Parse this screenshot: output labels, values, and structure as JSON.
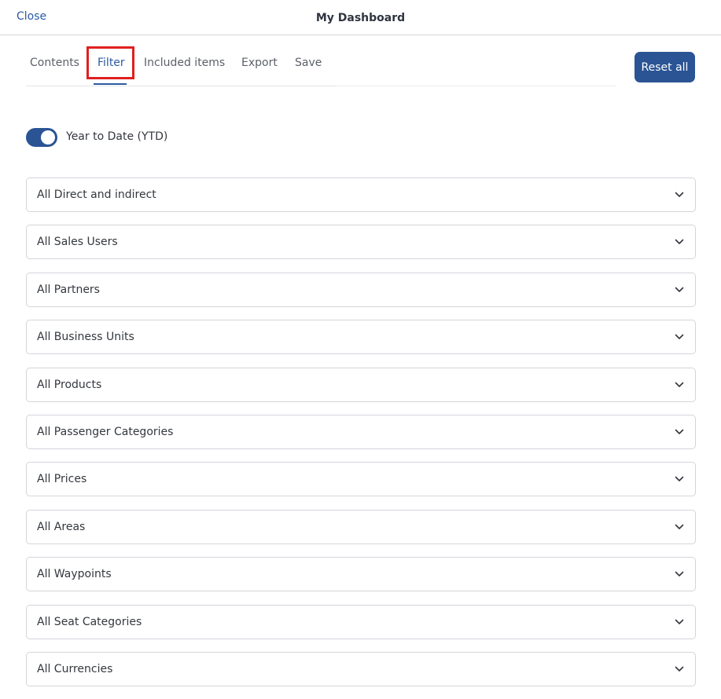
{
  "header": {
    "close_label": "Close",
    "title": "My Dashboard"
  },
  "tabs": [
    {
      "label": "Contents"
    },
    {
      "label": "Filter"
    },
    {
      "label": "Included items"
    },
    {
      "label": "Export"
    },
    {
      "label": "Save"
    }
  ],
  "active_tab": "Filter",
  "reset_label": "Reset all",
  "ytd": {
    "label": "Year to Date (YTD)",
    "enabled": true
  },
  "filters": [
    {
      "label": "All Direct and indirect"
    },
    {
      "label": "All Sales Users"
    },
    {
      "label": "All Partners"
    },
    {
      "label": "All Business Units"
    },
    {
      "label": "All Products"
    },
    {
      "label": "All Passenger Categories"
    },
    {
      "label": "All Prices"
    },
    {
      "label": "All Areas"
    },
    {
      "label": "All Waypoints"
    },
    {
      "label": "All Seat Categories"
    },
    {
      "label": "All Currencies"
    }
  ],
  "colors": {
    "accent": "#2a5494",
    "highlight": "#e0201f"
  }
}
